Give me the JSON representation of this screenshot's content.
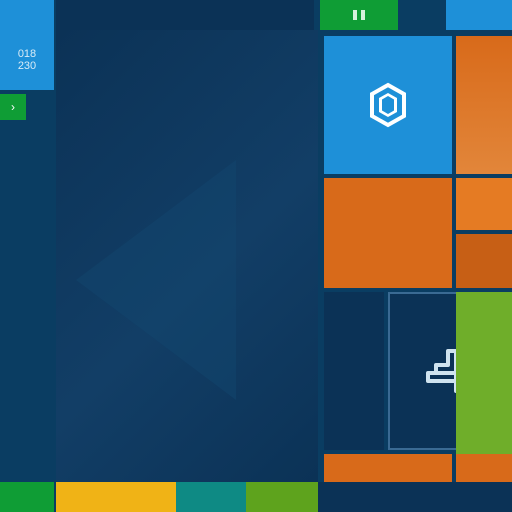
{
  "left": {
    "badge": "018\n230"
  },
  "tiles": {
    "security": {
      "icon": "hexagon-shield-icon"
    },
    "glyph": {
      "icon": "number-four-icon"
    },
    "top_green": {
      "icon": "pause-icon"
    }
  },
  "colors": {
    "accent_blue": "#1e90d8",
    "dark_blue": "#0b3256",
    "green": "#0f9d35",
    "olive": "#6fae2a",
    "orange": "#d86a1a",
    "yellow": "#f0b316",
    "teal": "#0e8a84"
  }
}
